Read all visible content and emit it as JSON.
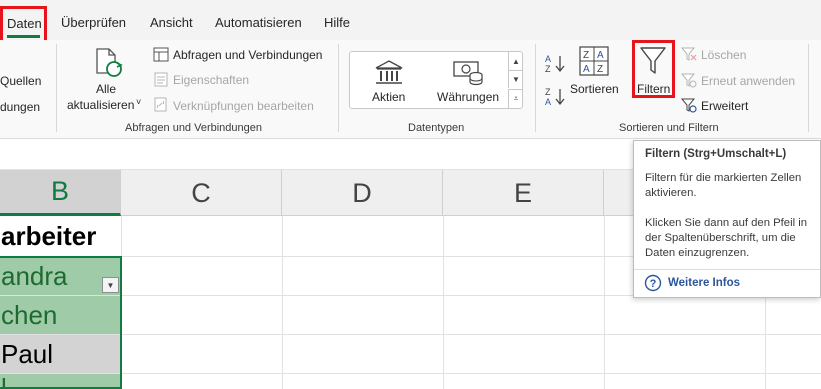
{
  "tabs": [
    {
      "label": "Daten",
      "active": true
    },
    {
      "label": "Überprüfen"
    },
    {
      "label": "Ansicht"
    },
    {
      "label": "Automatisieren"
    },
    {
      "label": "Hilfe"
    }
  ],
  "ribbon": {
    "get_data": {
      "line1": "Quellen",
      "line2": "dungen"
    },
    "queries": {
      "refresh_all_line1": "Alle",
      "refresh_all_line2": "aktualisieren",
      "queries_connections": "Abfragen und Verbindungen",
      "properties": "Eigenschaften",
      "edit_links": "Verknüpfungen bearbeiten",
      "group_label": "Abfragen und Verbindungen"
    },
    "datatypes": {
      "stocks": "Aktien",
      "currencies": "Währungen",
      "group_label": "Datentypen"
    },
    "sort_filter": {
      "sort": "Sortieren",
      "filter": "Filtern",
      "clear": "Löschen",
      "reapply": "Erneut anwenden",
      "advanced": "Erweitert",
      "group_label": "Sortieren und Filtern"
    }
  },
  "columns": [
    "B",
    "C",
    "D",
    "E"
  ],
  "cells": [
    {
      "text": "arbeiter",
      "bold": true
    },
    {
      "text": "andra"
    },
    {
      "text": "chen"
    },
    {
      "text": "Paul"
    },
    {
      "text": "l"
    }
  ],
  "tooltip": {
    "title": "Filtern (Strg+Umschalt+L)",
    "line1": "Filtern für die markierten Zellen",
    "line2": "aktivieren.",
    "line3": "Klicken Sie dann auf den Pfeil in",
    "line4": "der Spaltenüberschrift, um die",
    "line5": "Daten einzugrenzen.",
    "link": "Weitere Infos"
  },
  "colors": {
    "excel_green": "#107c41",
    "highlight_red": "#e8141b",
    "selection_fill": "#9fcba9",
    "link_blue": "#2b579a"
  }
}
